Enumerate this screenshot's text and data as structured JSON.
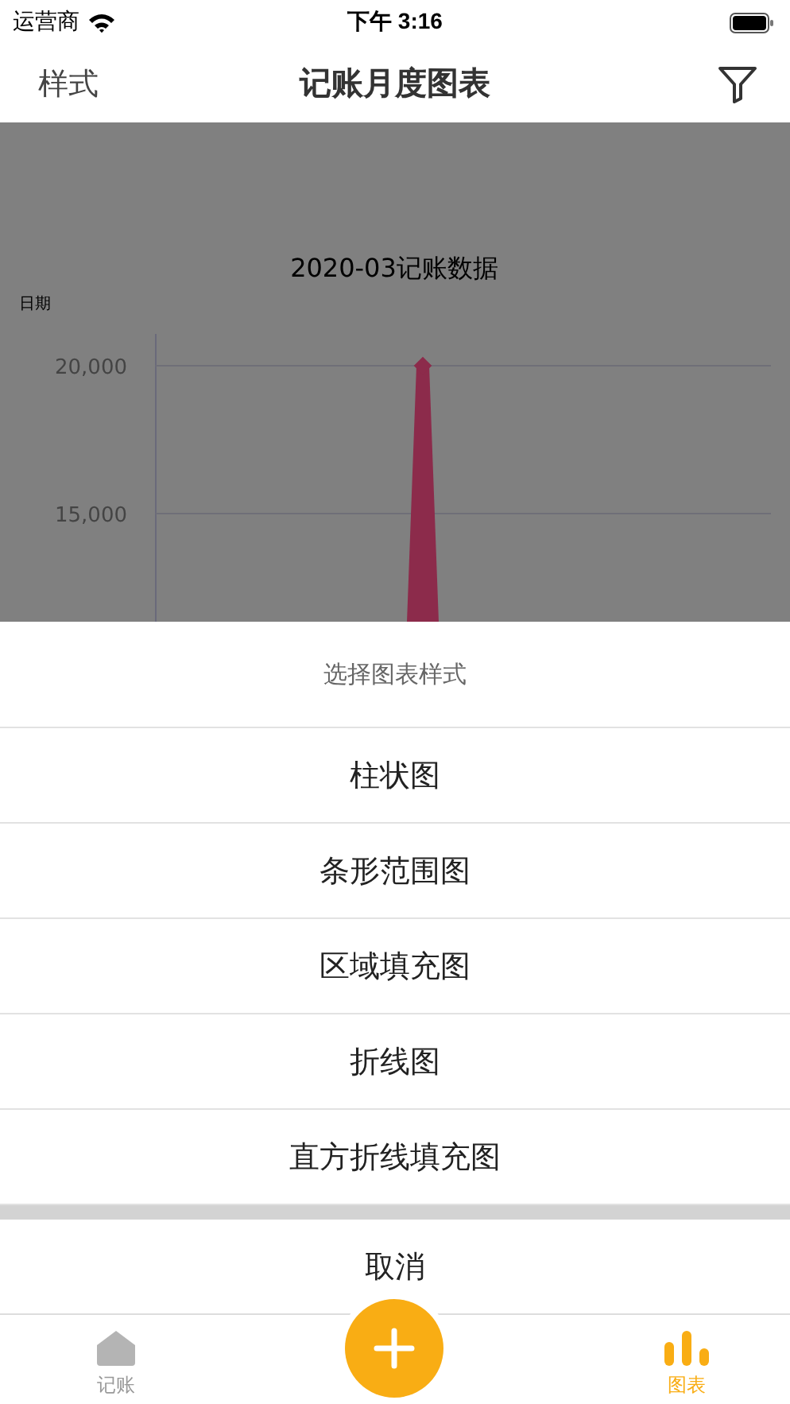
{
  "status_bar": {
    "carrier": "运营商",
    "time": "下午 3:16"
  },
  "nav": {
    "left": "样式",
    "title": "记账月度图表"
  },
  "chart": {
    "title": "2020-03记账数据",
    "y_axis_label": "日期",
    "y_tick_labels": [
      "20,000",
      "15,000"
    ]
  },
  "sheet": {
    "title": "选择图表样式",
    "options": [
      "柱状图",
      "条形范围图",
      "区域填充图",
      "折线图",
      "直方折线填充图"
    ],
    "cancel": "取消"
  },
  "tab_bar": {
    "items": [
      {
        "kind": "home",
        "label": "记账",
        "selected": false
      },
      {
        "kind": "chart",
        "label": "图表",
        "selected": true
      }
    ]
  }
}
